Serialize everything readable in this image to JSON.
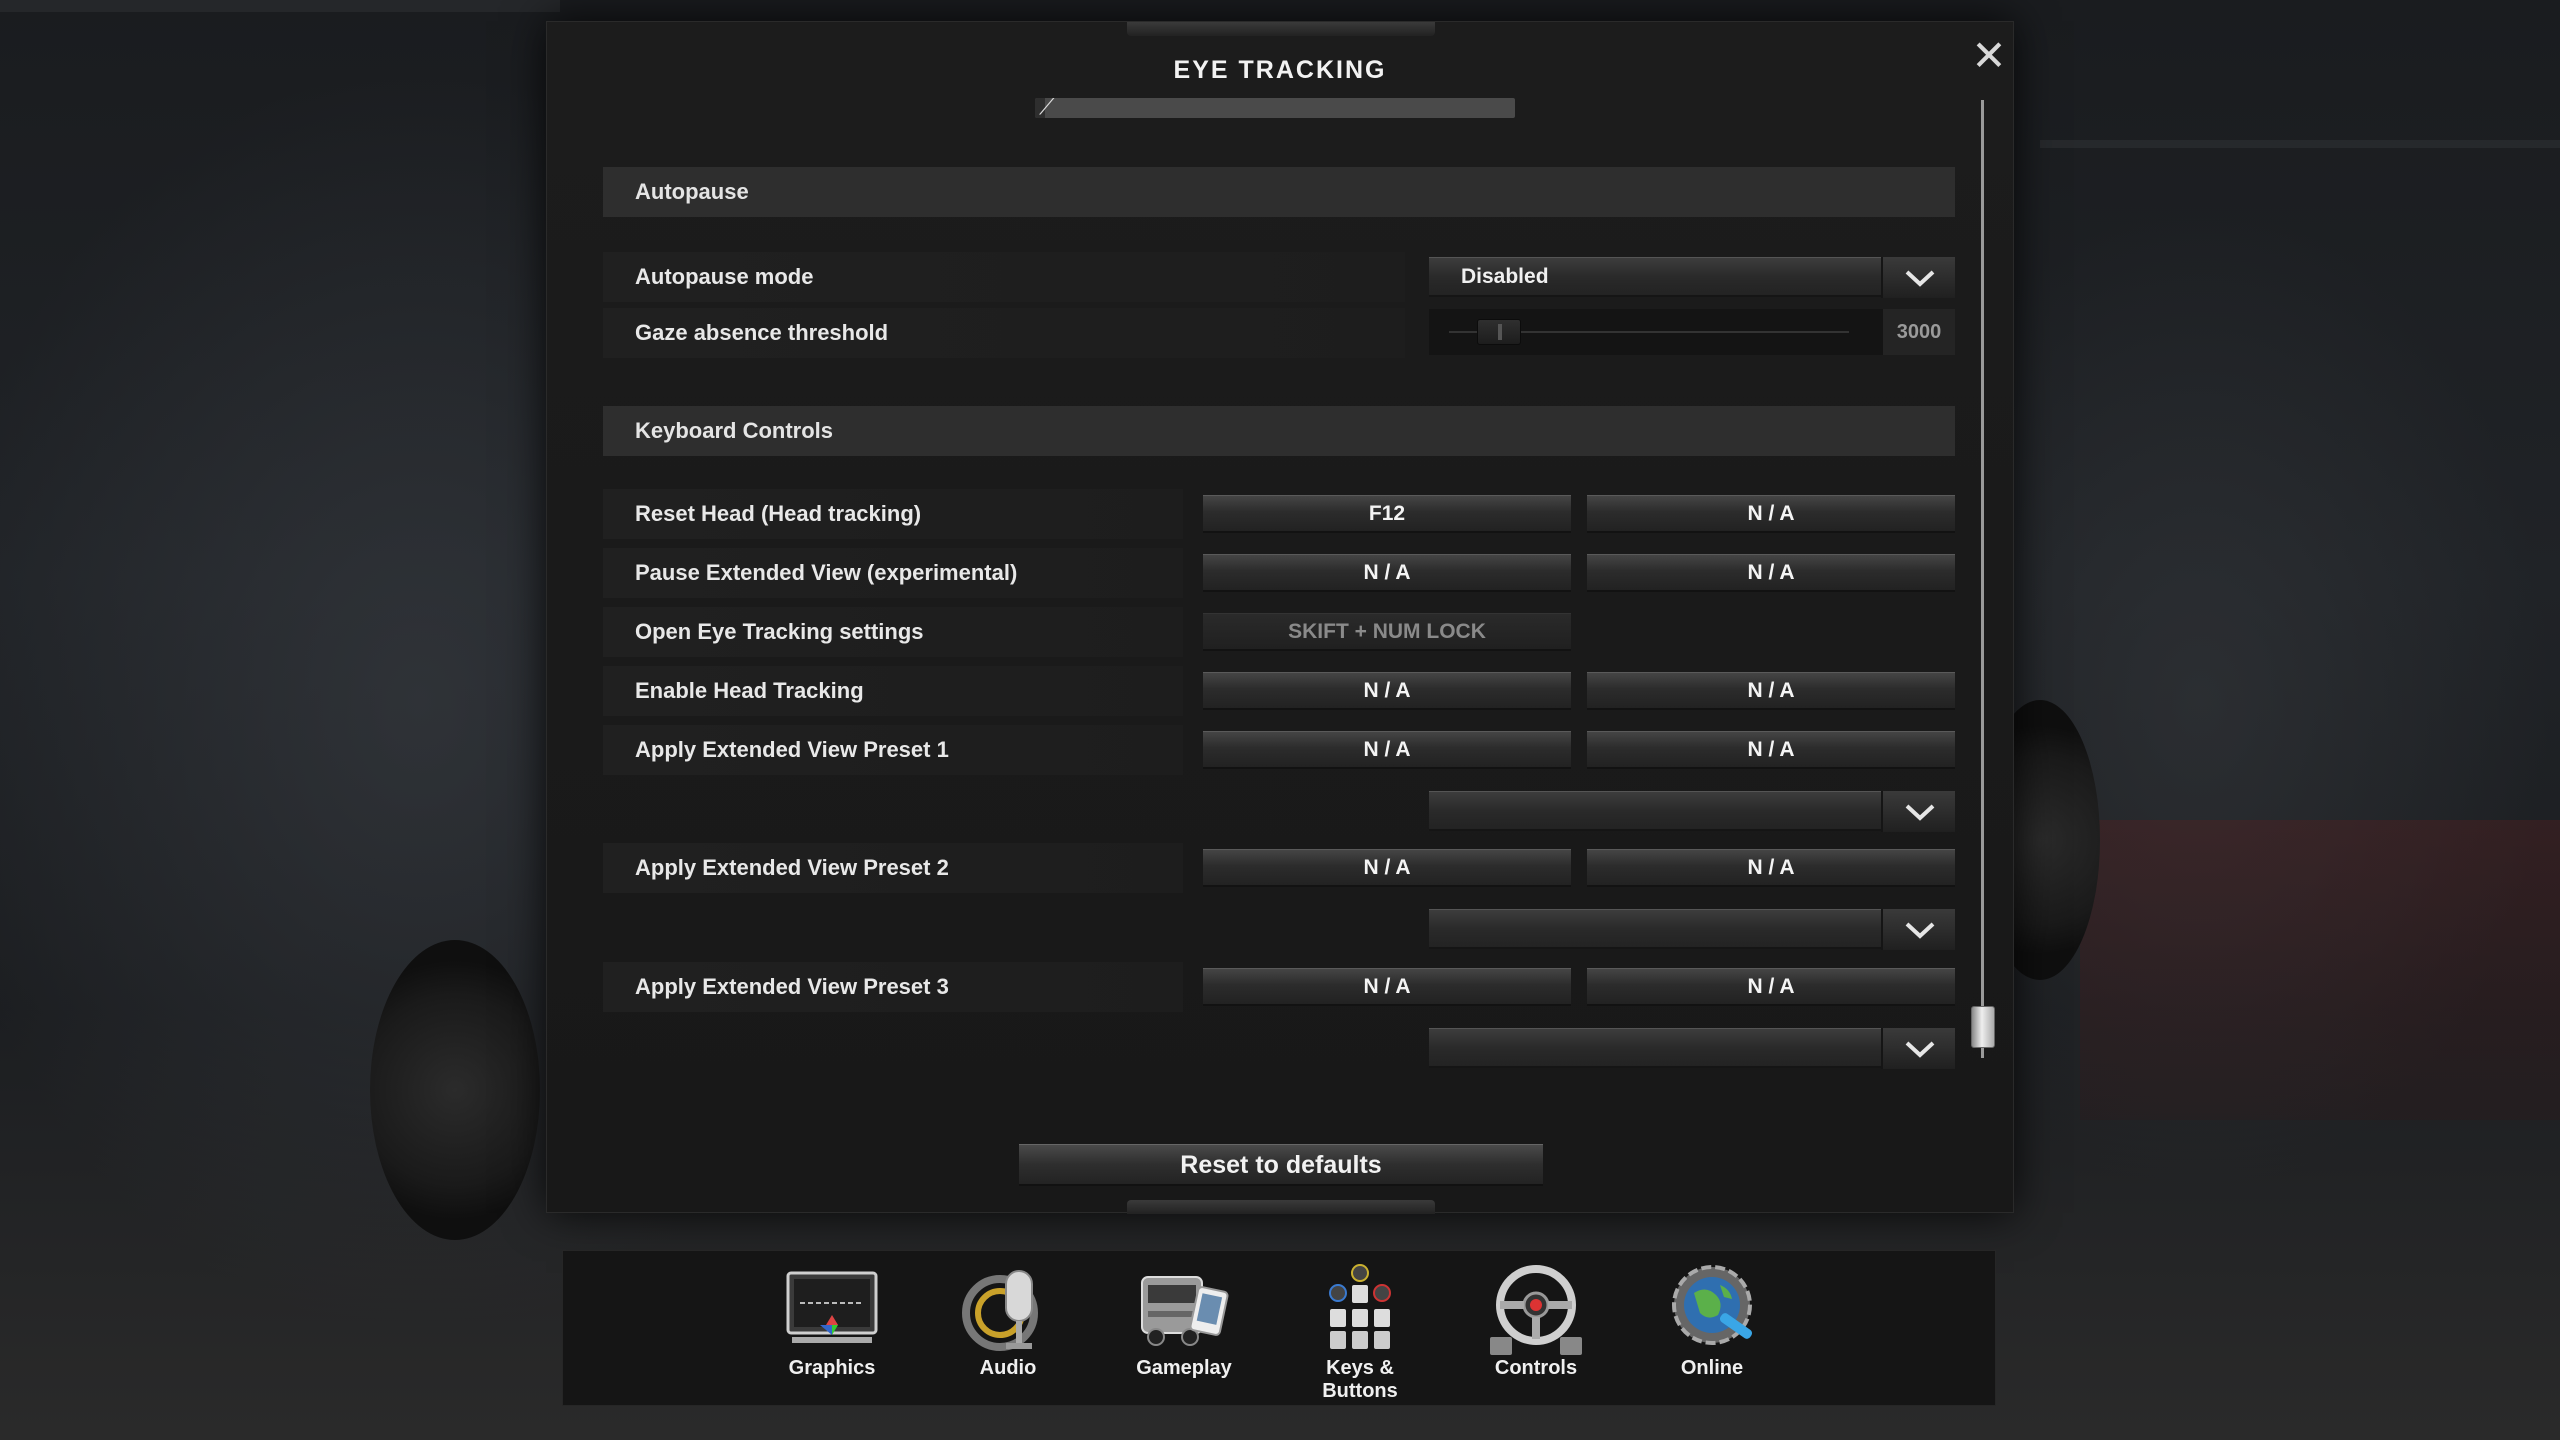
{
  "dialog": {
    "title": "EYE TRACKING",
    "close_icon": "close-icon",
    "top_progress": 0.02
  },
  "sections": {
    "autopause": "Autopause",
    "keyboard": "Keyboard Controls"
  },
  "autopause": {
    "mode_label": "Autopause mode",
    "mode_value": "Disabled",
    "gaze_label": "Gaze absence threshold",
    "gaze_value": "3000"
  },
  "controls": [
    {
      "label": "Reset Head (Head tracking)",
      "key1": "F12",
      "key2": "N / A"
    },
    {
      "label": "Pause Extended View (experimental)",
      "key1": "N / A",
      "key2": "N / A"
    },
    {
      "label": "Open Eye Tracking settings",
      "key1": "SKIFT + NUM LOCK",
      "key2": ""
    },
    {
      "label": "Enable Head Tracking",
      "key1": "N / A",
      "key2": "N / A"
    },
    {
      "label": "Apply Extended View Preset 1",
      "key1": "N / A",
      "key2": "N / A",
      "preset_value": ""
    },
    {
      "label": "Apply Extended View Preset 2",
      "key1": "N / A",
      "key2": "N / A",
      "preset_value": ""
    },
    {
      "label": "Apply Extended View Preset 3",
      "key1": "N / A",
      "key2": "N / A",
      "preset_value": ""
    }
  ],
  "reset_label": "Reset to defaults",
  "nav": [
    {
      "label": "Graphics",
      "icon": "monitor-icon"
    },
    {
      "label": "Audio",
      "icon": "microphone-icon"
    },
    {
      "label": "Gameplay",
      "icon": "truck-icon"
    },
    {
      "label": "Keys &\nButtons",
      "icon": "keys-buttons-icon"
    },
    {
      "label": "Controls",
      "icon": "steering-wheel-icon"
    },
    {
      "label": "Online",
      "icon": "globe-gear-icon"
    }
  ]
}
